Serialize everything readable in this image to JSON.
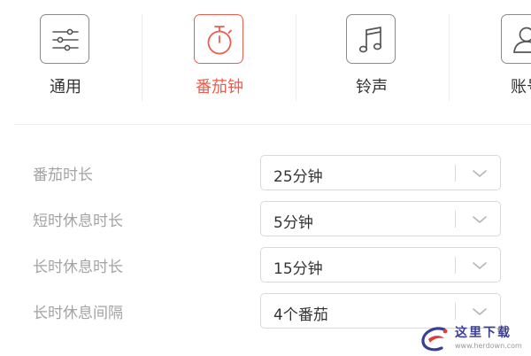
{
  "colors": {
    "accent": "#ec5d4d",
    "tile_border": "#8a8a8a",
    "label_gray": "#a3a3a3",
    "text": "#333333"
  },
  "tabs": [
    {
      "label": "通用",
      "icon": "sliders-icon",
      "active": false
    },
    {
      "label": "番茄钟",
      "icon": "stopwatch-icon",
      "active": true
    },
    {
      "label": "铃声",
      "icon": "music-note-icon",
      "active": false
    },
    {
      "label": "账号",
      "icon": "user-icon",
      "active": false
    }
  ],
  "settings": {
    "pomodoro_length": {
      "label": "番茄时长",
      "value": "25分钟"
    },
    "short_break": {
      "label": "短时休息时长",
      "value": "5分钟"
    },
    "long_break": {
      "label": "长时休息时长",
      "value": "15分钟"
    },
    "long_break_interval": {
      "label": "长时休息间隔",
      "value": "4个番茄"
    }
  },
  "watermark": {
    "name": "这里下载",
    "url": "www.herdown.com",
    "icon": "watermark-logo-icon"
  }
}
